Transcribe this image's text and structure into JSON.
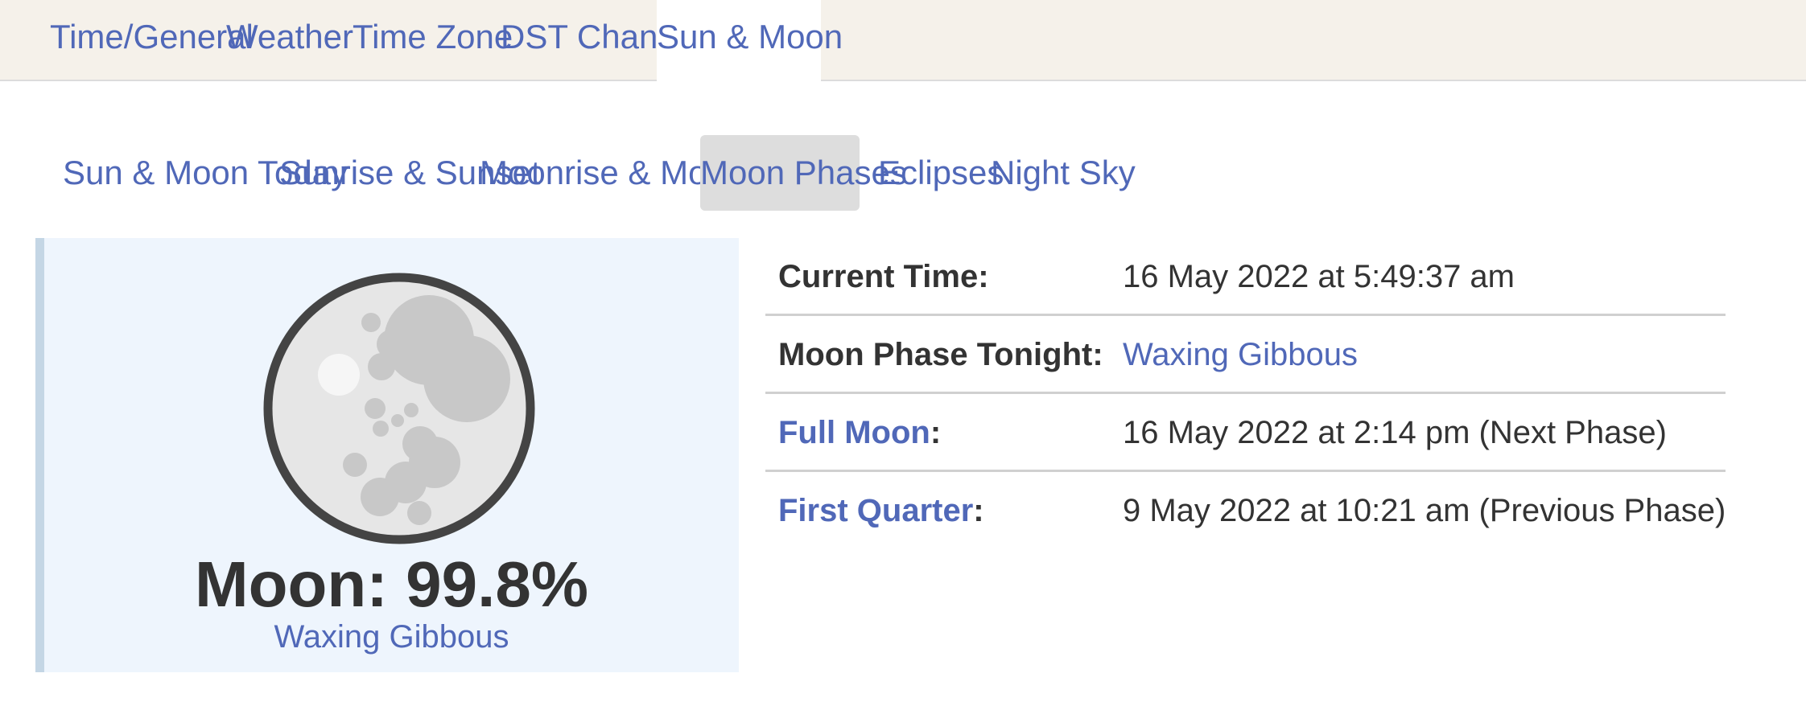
{
  "top_nav": {
    "tabs": [
      {
        "label": "Time/General",
        "active": false
      },
      {
        "label": "Weather",
        "active": false
      },
      {
        "label": "Time Zone",
        "active": false
      },
      {
        "label": "DST Changes",
        "active": false
      },
      {
        "label": "Sun & Moon",
        "active": true
      }
    ]
  },
  "sub_nav": {
    "items": [
      {
        "label": "Sun & Moon Today",
        "active": false
      },
      {
        "label": "Sunrise & Sunset",
        "active": false
      },
      {
        "label": "Moonrise & Moonset",
        "active": false
      },
      {
        "label": "Moon Phases",
        "active": true
      },
      {
        "label": "Eclipses",
        "active": false
      },
      {
        "label": "Night Sky",
        "active": false
      }
    ]
  },
  "moon": {
    "percent_label": "Moon: 99.8%",
    "illumination_percent": 99.8,
    "phase": "Waxing Gibbous",
    "icon": "moon-icon"
  },
  "info": {
    "current_time": {
      "label": "Current Time:",
      "value": "16 May 2022 at 5:49:37 am"
    },
    "phase_tonight": {
      "label": "Moon Phase Tonight:",
      "value": "Waxing Gibbous"
    },
    "next_phase": {
      "label_link": "Full Moon",
      "colon": ":",
      "value": "16 May 2022 at 2:14 pm (Next Phase)"
    },
    "previous_phase": {
      "label_link": "First Quarter",
      "colon": ":",
      "value": "9 May 2022 at 10:21 am (Previous Phase)"
    }
  },
  "colors": {
    "link": "#5068b8",
    "text": "#333333",
    "top_nav_bg": "#f5f1ea",
    "active_subnav_bg": "#dddddd",
    "panel_bg": "#eef5fd",
    "panel_border": "#c4d6e5"
  }
}
